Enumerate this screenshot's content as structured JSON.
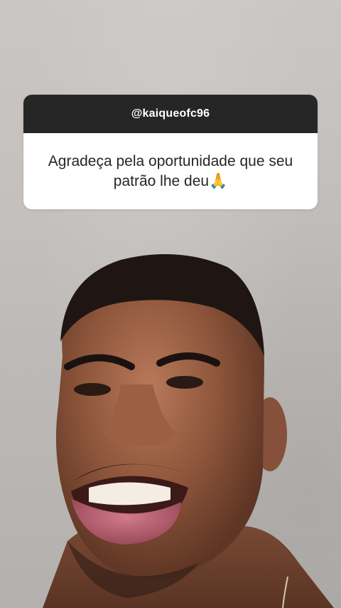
{
  "story": {
    "question_sticker": {
      "username": "@kaiqueofc96",
      "text": "Agradeça pela oportunidade que seu patrão lhe deu🙏"
    },
    "photo": {
      "icon": "person-face-photo"
    }
  },
  "colors": {
    "header_bg": "#262626",
    "body_bg": "#ffffff",
    "text_dark": "#262626",
    "wall": "#c3c0bd"
  }
}
